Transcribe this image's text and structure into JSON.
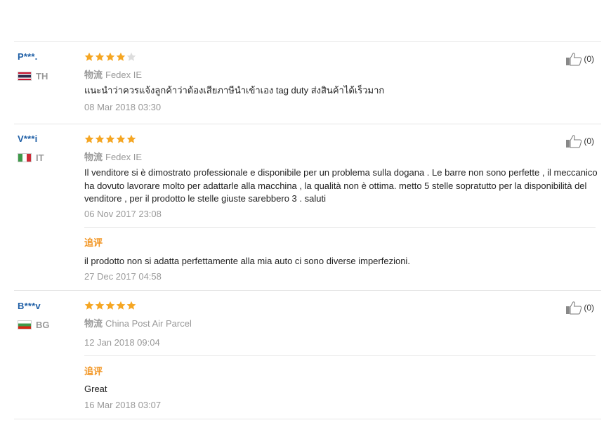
{
  "logistics_label": "物流",
  "followup_label": "追评",
  "reviews": [
    {
      "name": "P***.",
      "country": "TH",
      "rating": 4,
      "shipping": "Fedex IE",
      "text": "แนะนำว่าควรแจ้งลูกค้าว่าต้องเสียภาษีนำเข้าเอง tag duty ส่งสินค้าได้เร็วมาก",
      "date": "08 Mar 2018 03:30",
      "likes": "(0)"
    },
    {
      "name": "V***i",
      "country": "IT",
      "rating": 5,
      "shipping": "Fedex IE",
      "text": "Il venditore si è dimostrato professionale e disponibile per un problema sulla dogana . Le barre non sono perfette , il meccanico ha dovuto lavorare molto per adattarle alla macchina , la qualità non è ottima. metto 5 stelle sopratutto per la disponibilità del venditore , per il prodotto le stelle giuste sarebbero 3 . saluti",
      "date": "06 Nov 2017 23:08",
      "likes": "(0)",
      "followup": {
        "text": "il prodotto non si adatta perfettamente alla mia auto ci sono diverse imperfezioni.",
        "date": "27 Dec 2017 04:58"
      }
    },
    {
      "name": "B***v",
      "country": "BG",
      "rating": 5,
      "shipping": "China Post Air Parcel",
      "text": "",
      "date": "12 Jan 2018 09:04",
      "likes": "(0)",
      "followup": {
        "text": "Great",
        "date": "16 Mar 2018 03:07"
      }
    }
  ],
  "colors": {
    "star_filled": "#f5a623",
    "star_empty": "#dddddd",
    "name": "#1f5fa6",
    "followup": "#f29624",
    "muted": "#999999"
  }
}
